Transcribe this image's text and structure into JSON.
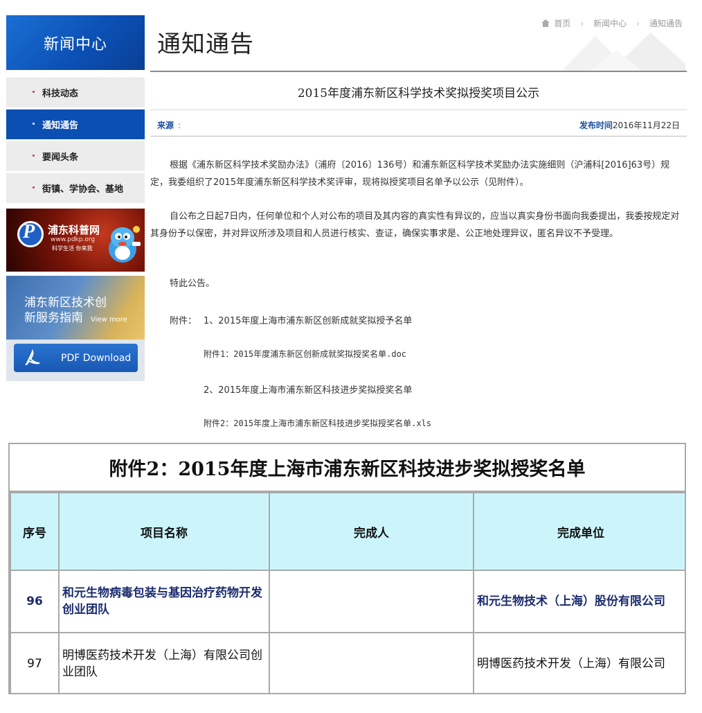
{
  "sidebar": {
    "header": "新闻中心",
    "items": [
      {
        "label": "科技动态"
      },
      {
        "label": "通知通告",
        "active": true
      },
      {
        "label": "要闻头条"
      },
      {
        "label": "街镇、学协会、基地"
      }
    ],
    "banner_pdkp": {
      "title": "浦东科普网",
      "url": "www.pdkp.org",
      "slogan": "科学生活 你来我"
    },
    "banner_guide": {
      "text_line1": "浦东新区技术创",
      "text_line2": "新服务指南",
      "more": "View more",
      "pdf_label": "PDF Download"
    }
  },
  "header": {
    "page_title": "通知通告",
    "breadcrumb": [
      "首页",
      "新闻中心",
      "通知通告"
    ]
  },
  "article": {
    "title": "2015年度浦东新区科学技术奖拟授奖项目公示",
    "source_label": "来源",
    "source_value": ":",
    "date_label": "发布时间",
    "date_value": "2016年11月22日",
    "para1": "根据《浦东新区科学技术奖励办法》（浦府〔2016〕136号）和浦东新区科学技术奖励办法实施细则（沪浦科[2016]63号）规定，我委组织了2015年度浦东新区科学技术奖评审，现将拟授奖项目名单予以公示（见附件）。",
    "para2": "自公布之日起7日内，任何单位和个人对公布的项目及其内容的真实性有异议的，应当以真实身份书面向我委提出，我委按规定对其身份予以保密，并对异议所涉及项目和人员进行核实、查证，确保实事求是、公正地处理异议，匿名异议不予受理。",
    "para3": "特此公告。",
    "attach_label": "附件：",
    "attach1": "1、2015年度上海市浦东新区创新成就奖拟授予名单",
    "attach1_file": "附件1：2015年度浦东新区创新成就奖拟授奖名单.doc",
    "attach2": "2、2015年度上海市浦东新区科技进步奖拟授奖名单",
    "attach2_file": "附件2：2015年度上海市浦东新区科技进步奖拟授奖名单.xls"
  },
  "table": {
    "title": "附件2：2015年度上海市浦东新区科技进步奖拟授奖名单",
    "headers": [
      "序号",
      "项目名称",
      "完成人",
      "完成单位"
    ],
    "rows": [
      {
        "no": "96",
        "project": "和元生物病毒包装与基因治疗药物开发创业团队",
        "people": "",
        "org": "和元生物技术（上海）股份有限公司"
      },
      {
        "no": "97",
        "project": "明博医药技术开发（上海）有限公司创业团队",
        "people": "",
        "org": "明博医药技术开发（上海）有限公司"
      }
    ]
  }
}
